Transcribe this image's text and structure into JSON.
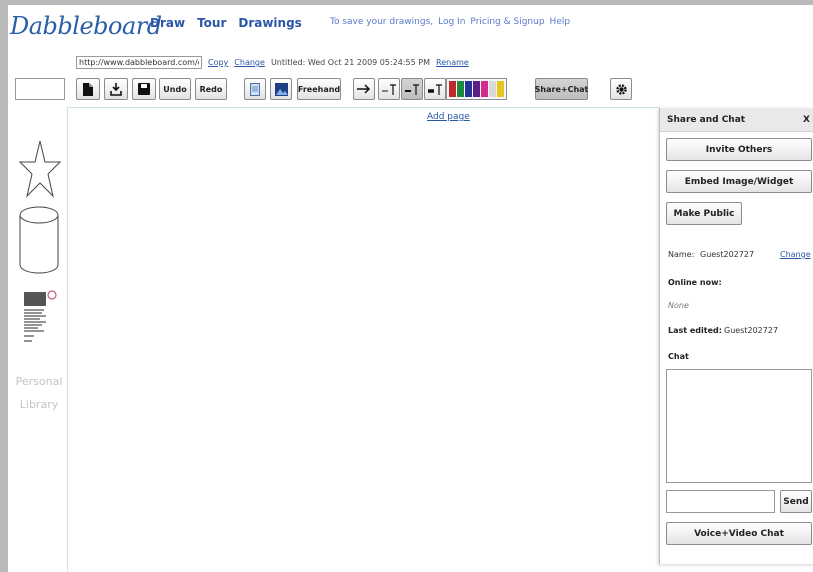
{
  "app": {
    "logo": "Dabbleboard",
    "nav": [
      "Draw",
      "Tour",
      "Drawings"
    ],
    "auth": {
      "prompt": "To save your drawings,",
      "login": "Log In",
      "pricing": "Pricing & Signup",
      "help": "Help"
    }
  },
  "doc": {
    "url": "http://www.dabbleboard.com/draw",
    "copy": "Copy",
    "change": "Change",
    "title": "Untitled: Wed Oct 21 2009 05:24:55 PM",
    "rename": "Rename"
  },
  "toolbar": {
    "undo": "Undo",
    "redo": "Redo",
    "freehand": "Freehand",
    "share_chat": "Share+Chat",
    "colors": [
      "#c0282b",
      "#1b8a3a",
      "#23339c",
      "#5c1f8a",
      "#d22b8d",
      "#d8d8d8",
      "#e8c620"
    ]
  },
  "canvas": {
    "add_page": "Add page"
  },
  "library": {
    "label_line1": "Personal",
    "label_line2": "Library"
  },
  "share_panel": {
    "title": "Share and Chat",
    "close": "X",
    "invite": "Invite Others",
    "embed": "Embed Image/Widget",
    "make_public": "Make Public",
    "name_label": "Name:",
    "name_value": "Guest202727",
    "name_change": "Change",
    "online_label": "Online now:",
    "online_value": "None",
    "last_edited_label": "Last edited:",
    "last_edited_value": "Guest202727",
    "chat_label": "Chat",
    "send": "Send",
    "voice": "Voice+Video Chat"
  }
}
